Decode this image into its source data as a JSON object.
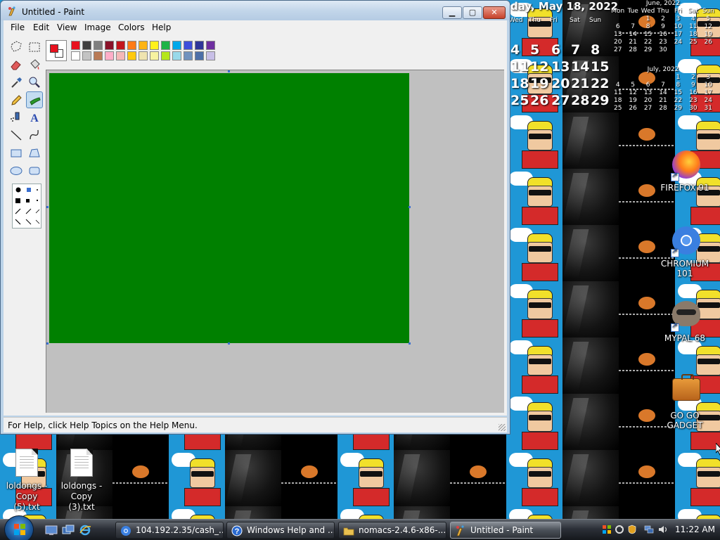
{
  "colors": {
    "canvas": "#008000",
    "foreground": "#e8111e",
    "background": "#ffffff"
  },
  "window": {
    "title": "Untitled - Paint",
    "menu": [
      "File",
      "Edit",
      "View",
      "Image",
      "Colors",
      "Help"
    ],
    "status": "For Help, click Help Topics on the Help Menu."
  },
  "palette": {
    "row1": [
      "#e8111e",
      "#3f3f3f",
      "#7f7f7f",
      "#8a1229",
      "#c3151c",
      "#ff7b17",
      "#ffb415",
      "#fff11c",
      "#1eb346",
      "#00a8ea",
      "#3e4fdb",
      "#2f3699",
      "#6e2fa0"
    ],
    "row2": [
      "#ffffff",
      "#c3c3c3",
      "#b97a56",
      "#ffaec8",
      "#f5b8b8",
      "#ffc90e",
      "#efe4b0",
      "#f7f3a0",
      "#b5e61d",
      "#99d9ea",
      "#7092be",
      "#4d6fa8",
      "#c8bfe7"
    ]
  },
  "tools": [
    {
      "name": "free-select-icon"
    },
    {
      "name": "rect-select-icon"
    },
    {
      "name": "eraser-icon"
    },
    {
      "name": "fill-icon"
    },
    {
      "name": "color-picker-icon"
    },
    {
      "name": "magnifier-icon"
    },
    {
      "name": "pencil-icon"
    },
    {
      "name": "brush-icon"
    },
    {
      "name": "airbrush-icon"
    },
    {
      "name": "text-icon"
    },
    {
      "name": "line-icon"
    },
    {
      "name": "curve-icon"
    },
    {
      "name": "rectangle-icon"
    },
    {
      "name": "polygon-icon"
    },
    {
      "name": "ellipse-icon"
    },
    {
      "name": "rounded-rect-icon"
    }
  ],
  "calendar": {
    "date_line": "day, May 18, 2022",
    "big_headers": [
      "Wed",
      "Thu",
      "Fri",
      "Sat",
      "Sun"
    ],
    "big_rows": [
      [
        "4",
        "5",
        "6",
        "7",
        "8"
      ],
      [
        "11",
        "12",
        "13",
        "14",
        "15"
      ],
      [
        "18",
        "19",
        "20",
        "21",
        "22"
      ],
      [
        "25",
        "26",
        "27",
        "28",
        "29"
      ]
    ],
    "june": {
      "title": "June, 2022",
      "days": [
        "Mon",
        "Tue",
        "Wed",
        "Thu",
        "Fri",
        "Sat",
        "Sun"
      ],
      "rows": [
        [
          "",
          "",
          "1",
          "2",
          "3",
          "4",
          "5"
        ],
        [
          "6",
          "7",
          "8",
          "9",
          "10",
          "11",
          "12"
        ],
        [
          "13",
          "14",
          "15",
          "16",
          "17",
          "18",
          "19"
        ],
        [
          "20",
          "21",
          "22",
          "23",
          "24",
          "25",
          "26"
        ],
        [
          "27",
          "28",
          "29",
          "30",
          "",
          "",
          ""
        ]
      ]
    },
    "july": {
      "title": "July, 2022",
      "rows": [
        [
          "",
          "",
          "",
          "",
          "1",
          "2",
          "3"
        ],
        [
          "4",
          "5",
          "6",
          "7",
          "8",
          "9",
          "10"
        ],
        [
          "11",
          "12",
          "13",
          "14",
          "15",
          "16",
          "17"
        ],
        [
          "18",
          "19",
          "20",
          "21",
          "22",
          "23",
          "24"
        ],
        [
          "25",
          "26",
          "27",
          "28",
          "29",
          "30",
          "31"
        ]
      ]
    }
  },
  "desktop_icons": [
    {
      "label": "FIREFOX 91",
      "icon": "firefox-icon"
    },
    {
      "label": "CHROMIUM 101",
      "icon": "chromium-icon"
    },
    {
      "label": "MYPAL 68",
      "icon": "mypal-icon"
    },
    {
      "label": "GO GO GADGET",
      "icon": "briefcase-icon"
    },
    {
      "label": "loldongs - Copy (5).txt",
      "icon": "text-file-icon"
    },
    {
      "label": "loldongs - Copy (3).txt",
      "icon": "text-file-icon"
    }
  ],
  "taskbar": {
    "tasks": [
      {
        "label": "104.192.2.35/cash_...",
        "icon": "chrome-icon"
      },
      {
        "label": "Windows Help and ...",
        "icon": "help-icon"
      },
      {
        "label": "nomacs-2.4.6-x86-...",
        "icon": "folder-icon"
      },
      {
        "label": "Untitled - Paint",
        "icon": "paint-icon"
      }
    ],
    "clock": "11:22 AM"
  }
}
